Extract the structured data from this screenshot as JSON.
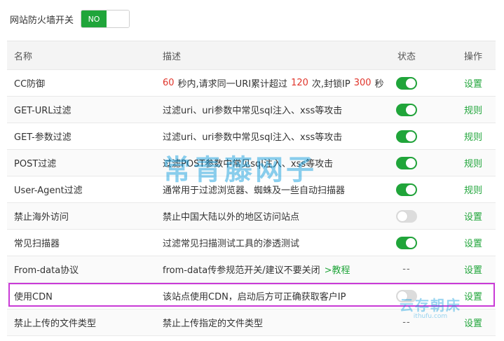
{
  "topbar": {
    "label": "网站防火墙开关",
    "toggle_text": "NO"
  },
  "table": {
    "headers": {
      "name": "名称",
      "desc": "描述",
      "status": "状态",
      "op": "操作"
    },
    "rows": [
      {
        "name": "CC防御",
        "desc_parts": [
          "60",
          "秒内,请求同一URI累计超过",
          "120",
          "次,封锁IP",
          "300",
          "秒"
        ],
        "status": "on",
        "op": "设置"
      },
      {
        "name": "GET-URL过滤",
        "desc": "过滤uri、uri参数中常见sql注入、xss等攻击",
        "status": "on",
        "op": "规则"
      },
      {
        "name": "GET-参数过滤",
        "desc": "过滤uri、uri参数中常见sql注入、xss等攻击",
        "status": "on",
        "op": "规则"
      },
      {
        "name": "POST过滤",
        "desc": "过滤POST参数中常见sql注入、xss等攻击",
        "status": "on",
        "op": "规则"
      },
      {
        "name": "User-Agent过滤",
        "desc": "通常用于过滤浏览器、蜘蛛及一些自动扫描器",
        "status": "on",
        "op": "规则"
      },
      {
        "name": "禁止海外访问",
        "desc": "禁止中国大陆以外的地区访问站点",
        "status": "off",
        "op": "设置"
      },
      {
        "name": "常见扫描器",
        "desc": "过滤常见扫描测试工具的渗透测试",
        "status": "on",
        "op": "设置"
      },
      {
        "name": "From-data协议",
        "desc": "from-data传参规范开关/建议不要关闭",
        "desc_link": ">教程",
        "status_text": "--",
        "op": "设置"
      },
      {
        "name": "使用CDN",
        "desc": "该站点使用CDN，启动后方可正确获取客户IP",
        "status": "off",
        "op": "设置"
      },
      {
        "name": "禁止上传的文件类型",
        "desc": "禁止上传指定的文件类型",
        "status_text": "--",
        "op": "设置"
      }
    ]
  },
  "watermark": {
    "main": "常青藤网子",
    "corner_big": "云存朝床",
    "corner_small": "ithufu.com"
  },
  "colors": {
    "accent_green": "#20a53a",
    "number_red": "#e0352b",
    "highlight_purple": "#c93ad6"
  }
}
